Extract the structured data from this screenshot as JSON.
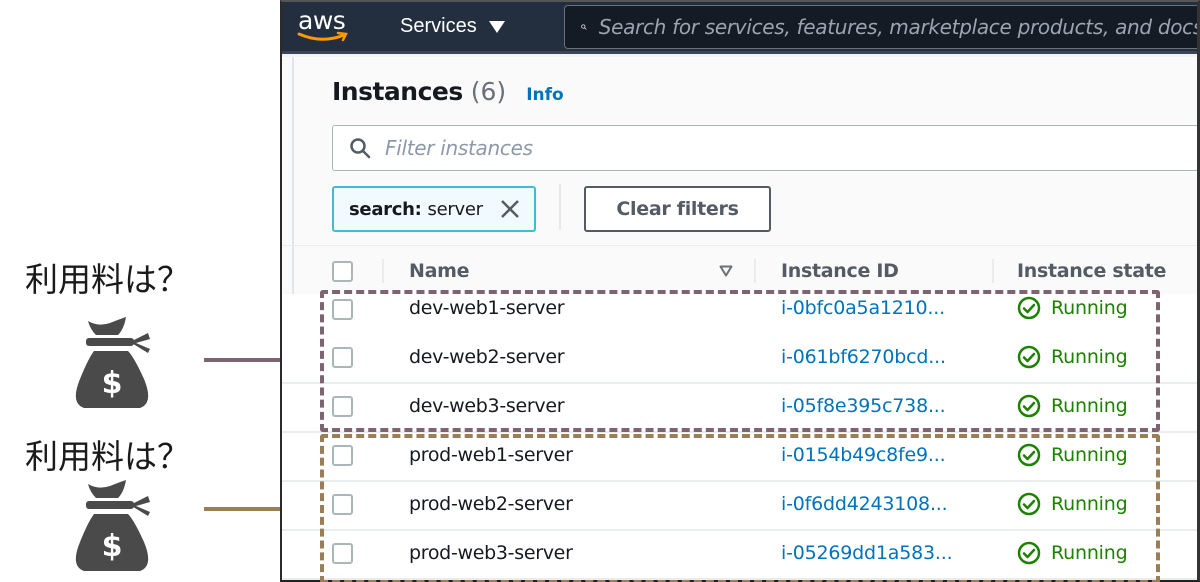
{
  "annotations": [
    {
      "label": "利用料は？",
      "icon": "money-bag-icon",
      "arrow_color": "#7d6470",
      "group": "dev"
    },
    {
      "label": "利用料は？",
      "icon": "money-bag-icon",
      "arrow_color": "#9b7d56",
      "group": "prod"
    }
  ],
  "colors": {
    "dev_group_border": "#7d6470",
    "prod_group_border": "#9b7d56",
    "running": "#1d8102",
    "link": "#0073bb",
    "topbar": "#232f3e",
    "aws_smile": "#ff9900"
  },
  "topbar": {
    "logo": "aws",
    "services_label": "Services",
    "search_placeholder": "Search for services, features, marketplace products, and docs"
  },
  "page": {
    "title": "Instances",
    "count": "(6)",
    "info_label": "Info",
    "filter_placeholder": "Filter instances",
    "token_key": "search:",
    "token_value": "server",
    "clear_filters_label": "Clear filters"
  },
  "table": {
    "columns": [
      "Name",
      "Instance ID",
      "Instance state"
    ],
    "rows": [
      {
        "name": "dev-web1-server",
        "instance_id": "i-0bfc0a5a1210...",
        "state": "Running"
      },
      {
        "name": "dev-web2-server",
        "instance_id": "i-061bf6270bcd...",
        "state": "Running"
      },
      {
        "name": "dev-web3-server",
        "instance_id": "i-05f8e395c738...",
        "state": "Running"
      },
      {
        "name": "prod-web1-server",
        "instance_id": "i-0154b49c8fe9...",
        "state": "Running"
      },
      {
        "name": "prod-web2-server",
        "instance_id": "i-0f6dd4243108...",
        "state": "Running"
      },
      {
        "name": "prod-web3-server",
        "instance_id": "i-05269dd1a583...",
        "state": "Running"
      }
    ]
  }
}
